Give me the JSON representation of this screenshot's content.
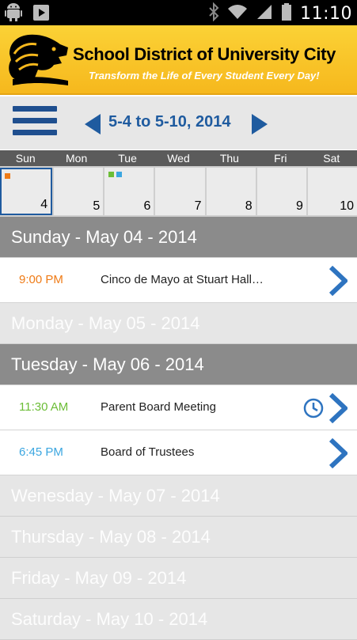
{
  "statusbar": {
    "time": "11:10",
    "icons": [
      "android-icon",
      "download-icon",
      "bluetooth-icon",
      "wifi-icon",
      "signal-icon",
      "battery-icon"
    ]
  },
  "banner": {
    "title": "School District of University City",
    "tagline": "Transform the Life of Every Student Every Day!"
  },
  "nav": {
    "range": "5-4 to 5-10, 2014",
    "accent_color": "#1f5b9f"
  },
  "week": {
    "headers": [
      "Sun",
      "Mon",
      "Tue",
      "Wed",
      "Thu",
      "Fri",
      "Sat"
    ],
    "days": [
      "4",
      "5",
      "6",
      "7",
      "8",
      "9",
      "10"
    ]
  },
  "agenda": {
    "sunday": {
      "header": "Sunday -  May 04 - 2014",
      "events": [
        {
          "time": "9:00 PM",
          "title": "Cinco de Mayo at Stuart Hall…",
          "color": "#ef7b16"
        }
      ]
    },
    "monday": {
      "header": "Monday - May 05 - 2014"
    },
    "tuesday": {
      "header": "Tuesday - May 06 - 2014",
      "events": [
        {
          "time": "11:30 AM",
          "title": "Parent Board Meeting",
          "color": "#6cbd37"
        },
        {
          "time": "6:45 PM",
          "title": "Board of Trustees",
          "color": "#3ba6e0"
        }
      ]
    },
    "wednesday": {
      "header": "Wenesday - May 07 - 2014"
    },
    "thursday": {
      "header": "Thursday - May 08 - 2014"
    },
    "friday": {
      "header": "Friday - May 09 - 2014"
    },
    "saturday": {
      "header": "Saturday - May 10 - 2014"
    }
  }
}
